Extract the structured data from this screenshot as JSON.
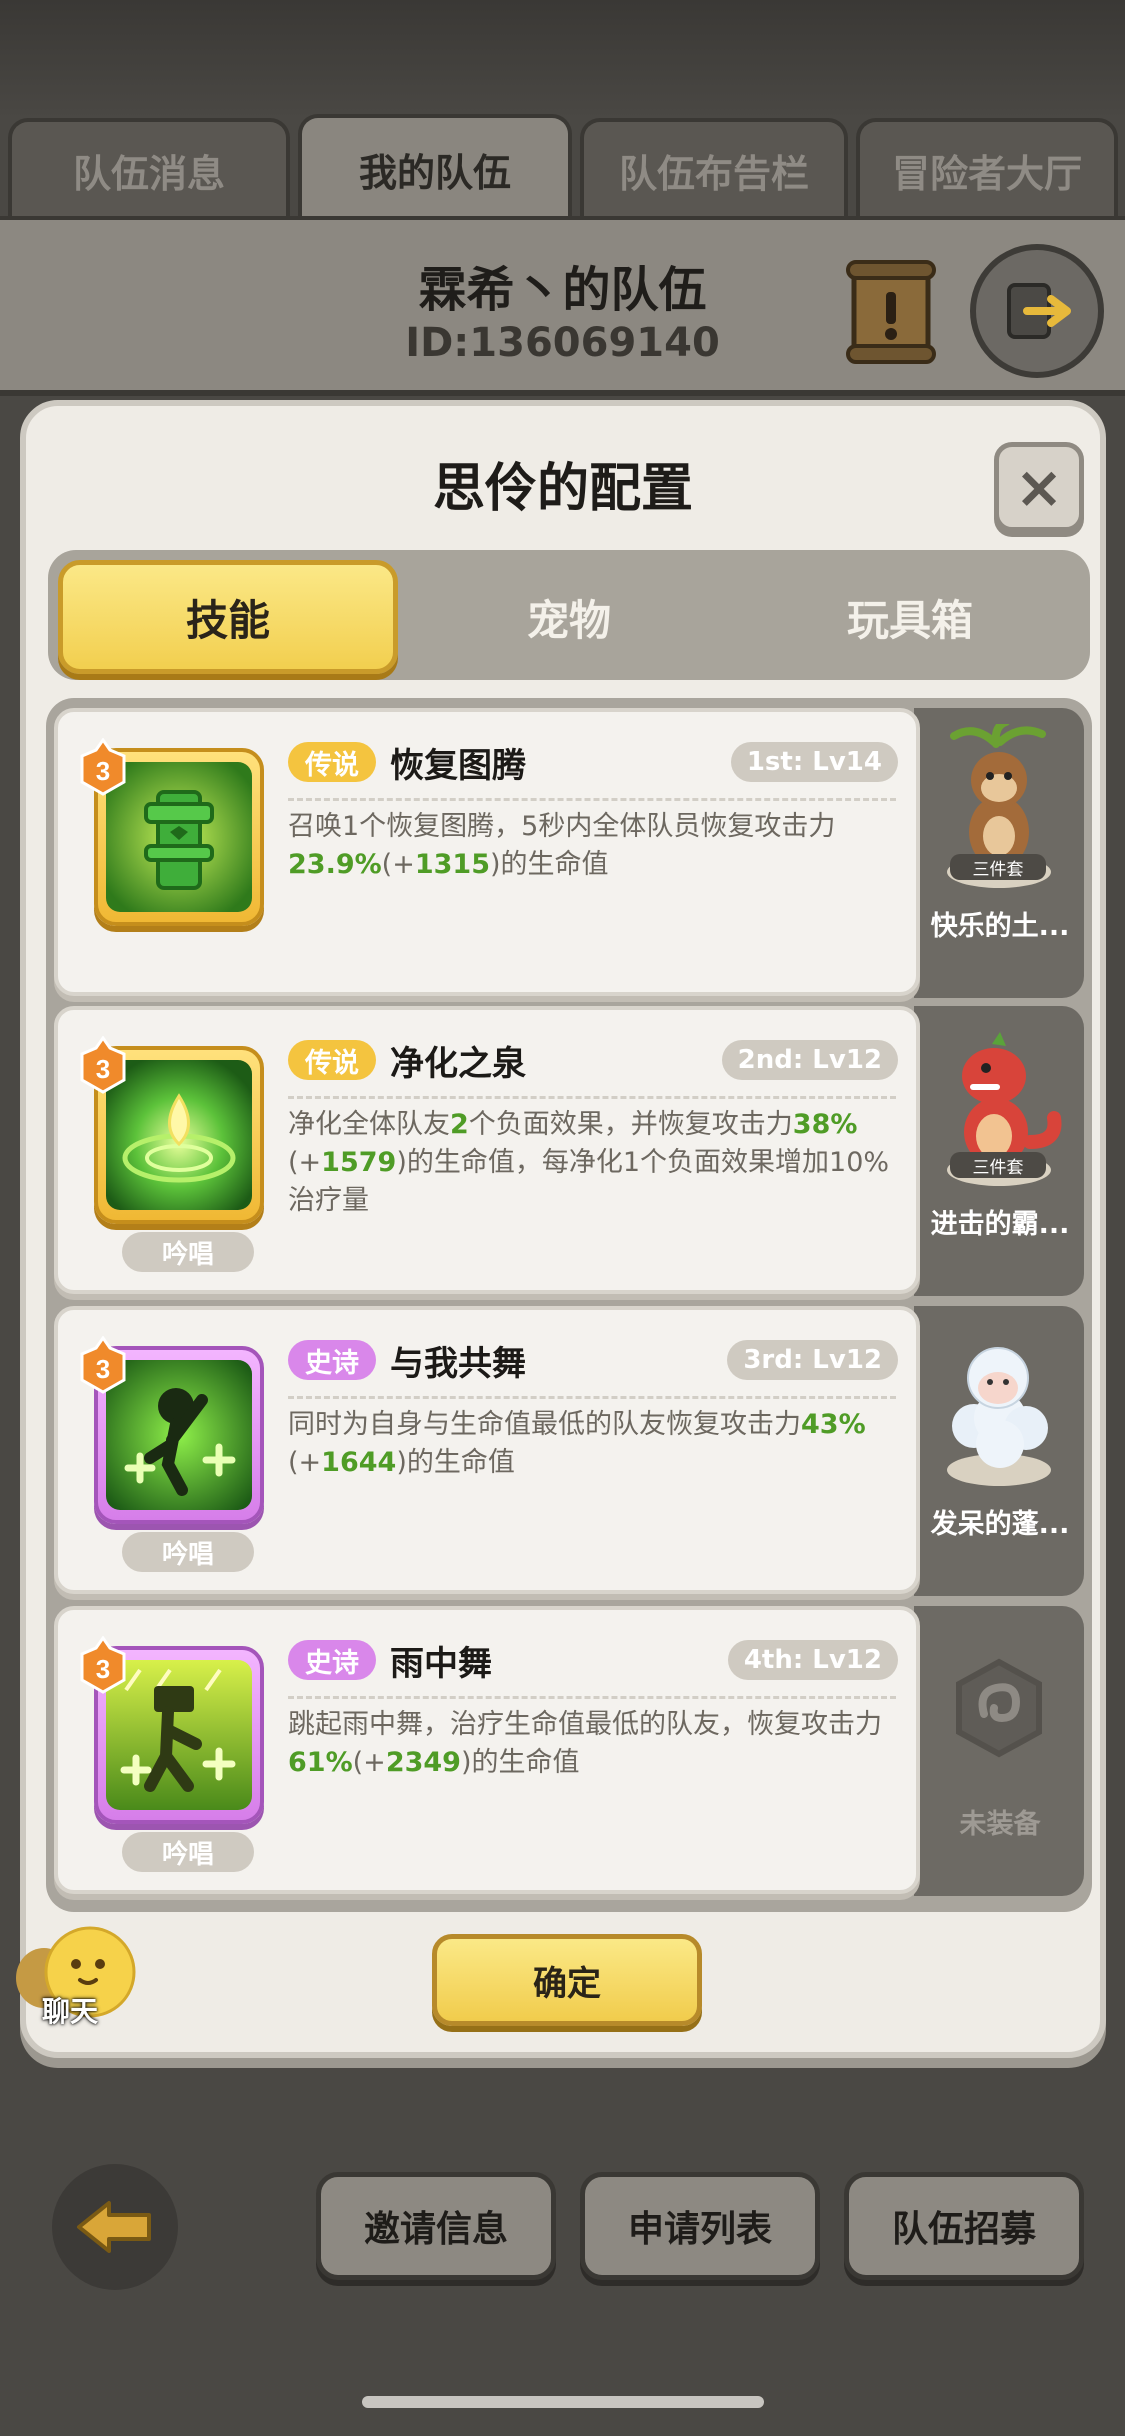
{
  "top_tabs": [
    {
      "label": "队伍消息",
      "active": false
    },
    {
      "label": "我的队伍",
      "active": true
    },
    {
      "label": "队伍布告栏",
      "active": false
    },
    {
      "label": "冒险者大厅",
      "active": false
    }
  ],
  "team": {
    "title": "霖希丶的队伍",
    "id_text": "ID:136069140"
  },
  "modal": {
    "title": "思伶的配置",
    "close_label": "×",
    "sub_tabs": [
      {
        "label": "技能",
        "active": true
      },
      {
        "label": "宠物",
        "active": false
      },
      {
        "label": "玩具箱",
        "active": false
      }
    ],
    "skills": [
      {
        "rarity": "传说",
        "rarity_type": "legend",
        "name": "恢复图腾",
        "slot": "1st: Lv14",
        "badge_level": "3",
        "chant": "",
        "desc": [
          [
            "召唤1个恢复图腾，5秒内全体队员恢复攻击力",
            false
          ],
          [
            "23.9%",
            true
          ],
          [
            "(+",
            false
          ],
          [
            "1315",
            true
          ],
          [
            ")的生命值",
            false
          ]
        ],
        "pet": {
          "label": "快乐的土...",
          "set_badge": "三件套",
          "equipped": true
        }
      },
      {
        "rarity": "传说",
        "rarity_type": "legend",
        "name": "净化之泉",
        "slot": "2nd: Lv12",
        "badge_level": "3",
        "chant": "吟唱",
        "desc": [
          [
            "净化全体队友",
            false
          ],
          [
            "2",
            true
          ],
          [
            "个负面效果，并恢复攻击力",
            false
          ],
          [
            "38%",
            true
          ],
          [
            "(+",
            false
          ],
          [
            "1579",
            true
          ],
          [
            ")的生命值，每净化1个负面效果增加10%治疗量",
            false
          ]
        ],
        "pet": {
          "label": "进击的霸...",
          "set_badge": "三件套",
          "equipped": true
        }
      },
      {
        "rarity": "史诗",
        "rarity_type": "epic",
        "name": "与我共舞",
        "slot": "3rd: Lv12",
        "badge_level": "3",
        "chant": "吟唱",
        "desc": [
          [
            "同时为自身与生命值最低的队友恢复攻击力",
            false
          ],
          [
            "43%",
            true
          ],
          [
            "(+",
            false
          ],
          [
            "1644",
            true
          ],
          [
            ")的生命值",
            false
          ]
        ],
        "pet": {
          "label": "发呆的蓬...",
          "set_badge": "",
          "equipped": true
        }
      },
      {
        "rarity": "史诗",
        "rarity_type": "epic",
        "name": "雨中舞",
        "slot": "4th: Lv12",
        "badge_level": "3",
        "chant": "吟唱",
        "desc": [
          [
            "跳起雨中舞，治疗生命值最低的队友，恢复攻击力",
            false
          ],
          [
            "61%",
            true
          ],
          [
            "(+",
            false
          ],
          [
            "2349",
            true
          ],
          [
            ")的生命值",
            false
          ]
        ],
        "pet": {
          "label": "未装备",
          "set_badge": "",
          "equipped": false
        }
      }
    ],
    "confirm_label": "确定"
  },
  "chat": {
    "label": "聊天"
  },
  "bottom_buttons": [
    "邀请信息",
    "申请列表",
    "队伍招募"
  ],
  "colors": {
    "gold": "#f2cf4f",
    "epic": "#d987ea",
    "value_green": "#4f9c26"
  }
}
